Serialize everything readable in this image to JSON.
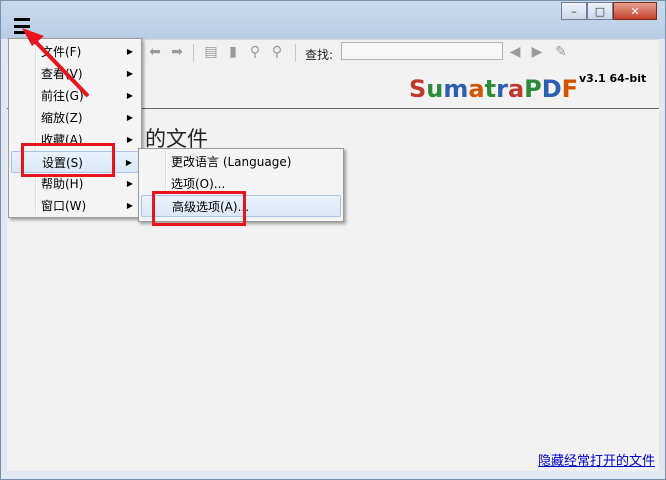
{
  "window": {
    "min_label": "–",
    "max_label": "□",
    "close_label": "✕"
  },
  "toolbar": {
    "find_label": "查找:",
    "find_value": ""
  },
  "logo": {
    "text": "SumatraPDF",
    "version": "v3.1 64-bit",
    "letters": [
      {
        "ch": "S",
        "color": "#c0392b"
      },
      {
        "ch": "u",
        "color": "#2e8b3a"
      },
      {
        "ch": "m",
        "color": "#2d5fb0"
      },
      {
        "ch": "a",
        "color": "#d35400"
      },
      {
        "ch": "t",
        "color": "#2e8b3a"
      },
      {
        "ch": "r",
        "color": "#2d5fb0"
      },
      {
        "ch": "a",
        "color": "#c0392b"
      },
      {
        "ch": "P",
        "color": "#2e8b3a"
      },
      {
        "ch": "D",
        "color": "#2d5fb0"
      },
      {
        "ch": "F",
        "color": "#d35400"
      }
    ]
  },
  "content": {
    "recent_title": "的文件",
    "hide_link": "隐藏经常打开的文件"
  },
  "main_menu": [
    {
      "label": "文件(F)"
    },
    {
      "label": "查看(V)"
    },
    {
      "label": "前往(G)"
    },
    {
      "label": "缩放(Z)"
    },
    {
      "label": "收藏(A)"
    },
    {
      "label": "设置(S)"
    },
    {
      "label": "帮助(H)"
    },
    {
      "label": "窗口(W)"
    }
  ],
  "settings_menu": [
    {
      "label": "更改语言 (Language)"
    },
    {
      "label": "选项(O)..."
    },
    {
      "label": "高级选项(A)..."
    }
  ],
  "colors": {
    "annotation_red": "#e8141d",
    "link": "#0000cc"
  }
}
